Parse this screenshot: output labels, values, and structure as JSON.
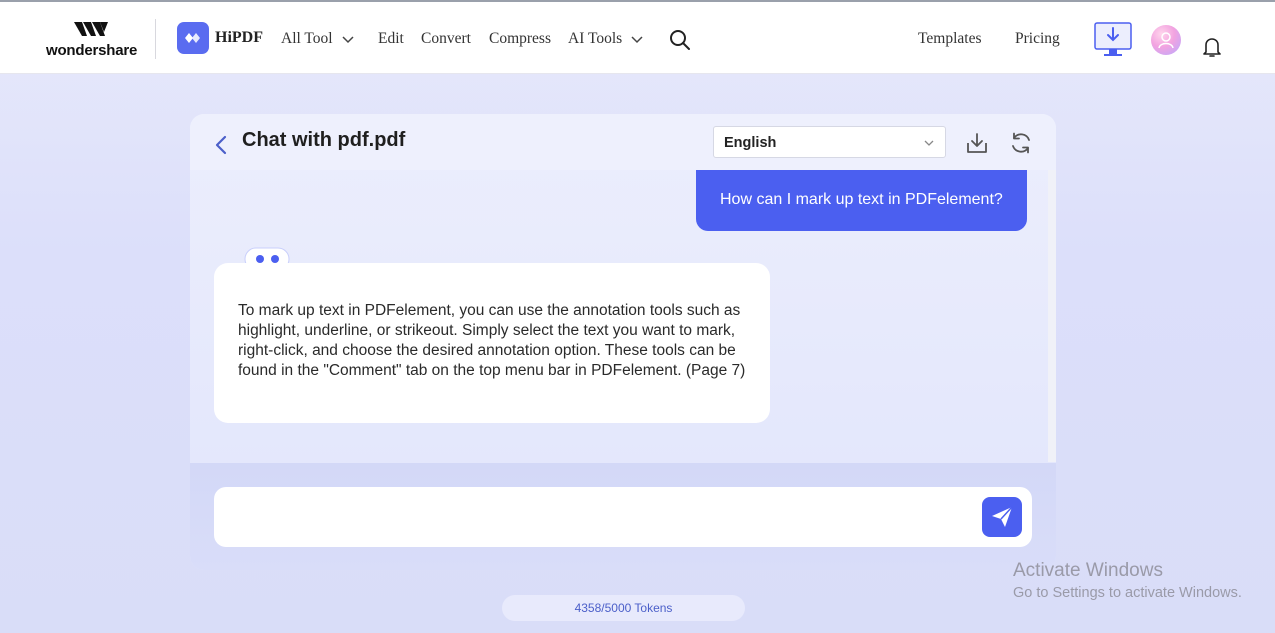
{
  "header": {
    "brand_word": "wondershare",
    "product_name": "HiPDF",
    "nav": {
      "all_tool": "All Tool",
      "edit": "Edit",
      "convert": "Convert",
      "compress": "Compress",
      "ai_tools": "AI Tools",
      "templates": "Templates",
      "pricing": "Pricing"
    },
    "icons": [
      "wondershare-logo-icon",
      "hipdf-logo-icon",
      "chevron-down-icon",
      "search-icon",
      "desktop-download-icon",
      "avatar-icon",
      "bell-icon"
    ]
  },
  "chat": {
    "title": "Chat with pdf.pdf",
    "language": {
      "selected": "English"
    },
    "messages": [
      {
        "role": "user",
        "text": "How can I mark up text in PDFelement?"
      },
      {
        "role": "assistant",
        "text": "To mark up text in PDFelement, you can use the annotation tools such as highlight, underline, or strikeout. Simply select the text you want to mark, right-click, and choose the desired annotation option. These tools can be found in the \"Comment\" tab on the top menu bar in PDFelement. (Page 7)"
      }
    ],
    "input": {
      "value": "",
      "placeholder": ""
    },
    "tokens": "4358/5000 Tokens"
  },
  "watermark": {
    "line1": "Activate Windows",
    "line2": "Go to Settings to activate Windows."
  },
  "colors": {
    "accent": "#4b5ff0",
    "background": "#dcdffa",
    "header_bg": "#ffffff"
  }
}
